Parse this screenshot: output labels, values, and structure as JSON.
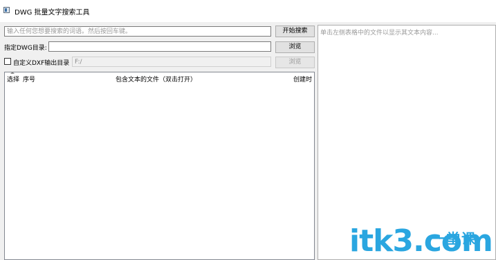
{
  "window": {
    "title": "DWG 批量文字搜索工具"
  },
  "search": {
    "placeholder": "输入任何您想要搜索的词语。然后按回车键。",
    "button_label": "开始搜索"
  },
  "dwg_dir": {
    "label": "指定DWG目录:",
    "value": "",
    "browse_label": "浏览"
  },
  "dxf_output": {
    "checkbox_label": "自定义DXF输出目录",
    "checked": false,
    "value": "F:/",
    "browse_label": "浏览"
  },
  "table": {
    "columns": [
      "选择",
      "序号",
      "包含文本的文件（双击打开）",
      "创建时"
    ],
    "rows": []
  },
  "preview": {
    "placeholder": "单击左侧表格中的文件以显示其文本内容..."
  },
  "watermark": {
    "text": "itk3.com",
    "cn_text": "一堂课"
  }
}
